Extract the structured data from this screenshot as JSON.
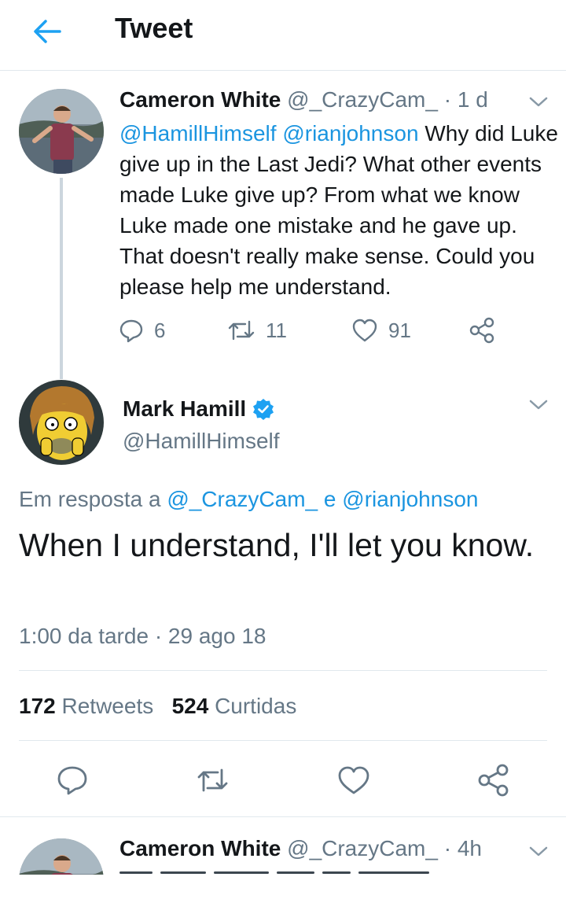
{
  "header": {
    "title": "Tweet"
  },
  "parent_tweet": {
    "name": "Cameron White",
    "handle": "@_CrazyCam_",
    "age": "1 d",
    "mentions": [
      "@HamillHimself",
      "@rianjohnson"
    ],
    "text": "Why did Luke give up in the Last Jedi? What other events made Luke give up? From what we know Luke made one mistake and he gave up. That doesn't really make sense. Could you please help me understand.",
    "replies": "6",
    "retweets": "11",
    "likes": "91"
  },
  "main_tweet": {
    "name": "Mark Hamill",
    "handle": "@HamillHimself",
    "reply_prefix": "Em resposta a",
    "reply_user_1": "@_CrazyCam_",
    "reply_conj": "e",
    "reply_user_2": "@rianjohnson",
    "text": "When I understand, I'll let you know.",
    "time": "1:00 da tarde",
    "date": "29 ago 18",
    "retweet_count": "172",
    "retweet_label": "Retweets",
    "like_count": "524",
    "like_label": "Curtidas"
  },
  "next_tweet": {
    "name": "Cameron White",
    "handle": "@_CrazyCam_",
    "age": "4h"
  },
  "colors": {
    "link": "#1b95e0",
    "secondary": "#657786",
    "primary": "#14171a",
    "divider": "#e1e8ed",
    "icon": "#657786"
  },
  "icons": [
    "back-arrow-icon",
    "chevron-down-icon",
    "reply-icon",
    "retweet-icon",
    "like-icon",
    "share-icon",
    "verified-badge-icon"
  ]
}
